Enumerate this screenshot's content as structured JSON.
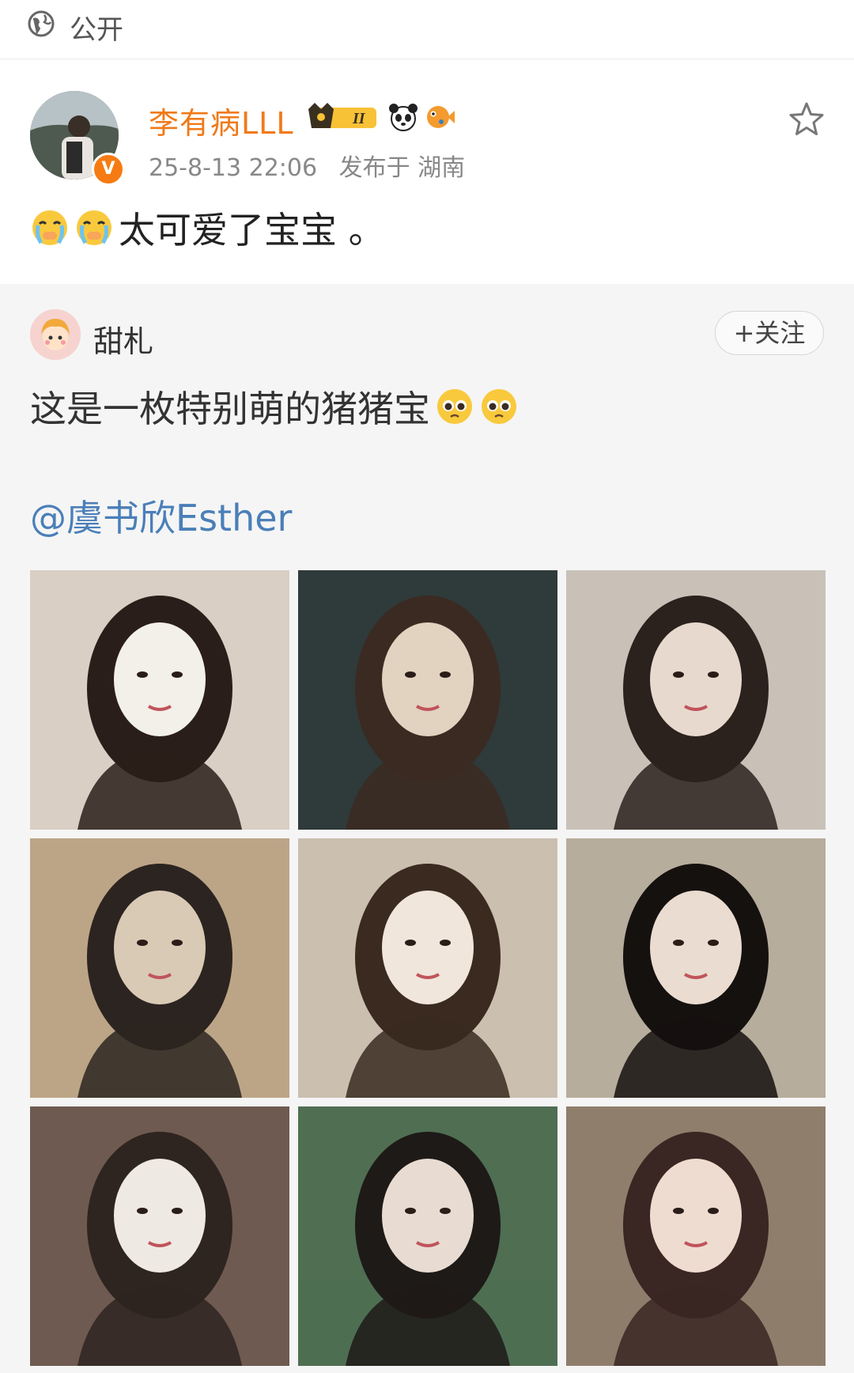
{
  "topbar": {
    "privacy_label": "公开",
    "privacy_icon": "globe-icon"
  },
  "post": {
    "username": "李有病LLL",
    "timestamp": "25-8-13 22:06",
    "location": "发布于 湖南",
    "text": "太可爱了宝宝 。",
    "badge_level": "II",
    "verified_mark": "V"
  },
  "repost": {
    "username": "甜札",
    "follow_label": "+关注",
    "text": "这是一枚特别萌的猪猪宝",
    "mention": "@虞书欣Esther",
    "photos": [
      {
        "tones": [
          "#d9cfc4",
          "#f3efe9",
          "#2a1e1a"
        ]
      },
      {
        "tones": [
          "#2f3a3a",
          "#e2d2c0",
          "#3b2a22"
        ]
      },
      {
        "tones": [
          "#c9c1b8",
          "#e8d9cf",
          "#2b211d"
        ]
      },
      {
        "tones": [
          "#bca587",
          "#d9cab6",
          "#2c2420"
        ]
      },
      {
        "tones": [
          "#cbbfb0",
          "#f0e6dc",
          "#3a2a20"
        ]
      },
      {
        "tones": [
          "#b7ad9c",
          "#eadcd0",
          "#15110f"
        ]
      },
      {
        "tones": [
          "#6e5a50",
          "#efe9e3",
          "#2e2520"
        ]
      },
      {
        "tones": [
          "#4f6e52",
          "#e8dcd2",
          "#1e1a18"
        ]
      },
      {
        "tones": [
          "#8f7e6c",
          "#efdcd0",
          "#3a2622"
        ]
      }
    ]
  }
}
